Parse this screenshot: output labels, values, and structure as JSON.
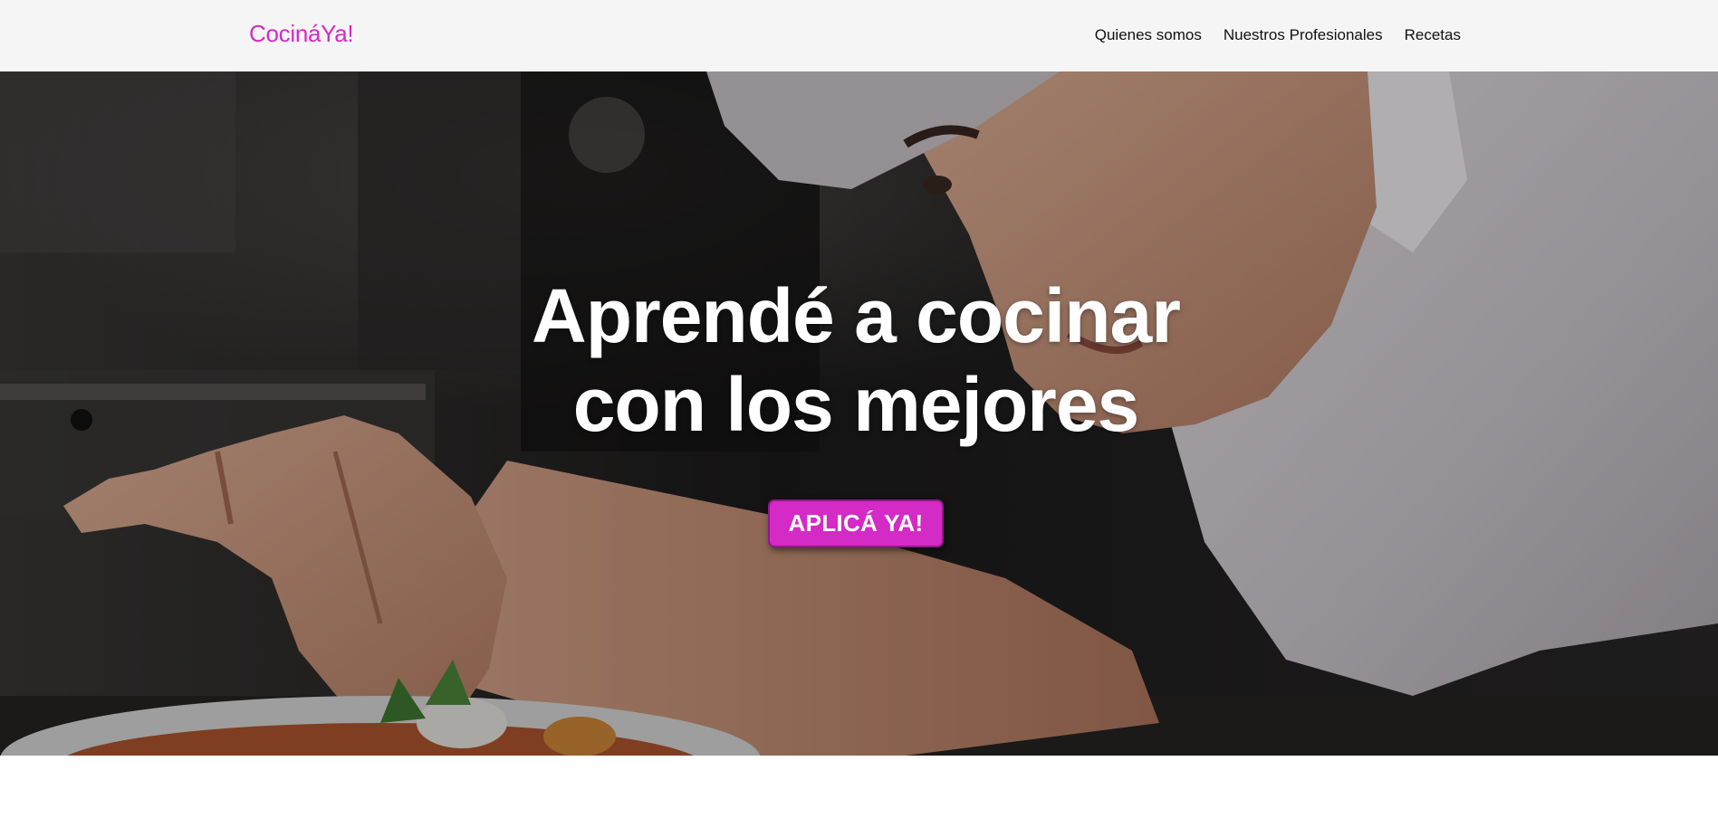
{
  "navbar": {
    "brand": "CocináYa!",
    "links": [
      {
        "label": "Quienes somos"
      },
      {
        "label": "Nuestros Profesionales"
      },
      {
        "label": "Recetas"
      }
    ]
  },
  "hero": {
    "title": "Aprendé a cocinar\ncon los mejores",
    "cta_label": "APLICÁ YA!",
    "image": "chef-plating-dish-photo"
  },
  "colors": {
    "accent": "#d42ac6",
    "navbar_bg": "#f5f5f5",
    "hero_text": "#ffffff"
  }
}
